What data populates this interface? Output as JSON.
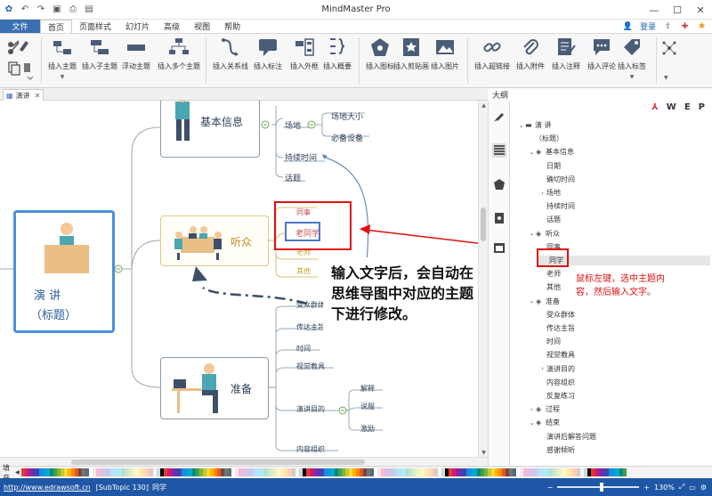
{
  "app": {
    "title": "MindMaster Pro",
    "quick_access": [
      "logo-icon",
      "undo-icon",
      "redo-icon",
      "save-icon",
      "print-icon",
      "export-icon"
    ]
  },
  "menu": {
    "file": "文件",
    "tabs": [
      "首页",
      "页面样式",
      "幻灯片",
      "高级",
      "视图",
      "帮助"
    ],
    "active_index": 0,
    "login": "登录"
  },
  "ribbon": {
    "buttons": [
      {
        "label": "插入主题",
        "icon": "insert-topic-icon"
      },
      {
        "label": "插入子主题",
        "icon": "insert-subtopic-icon"
      },
      {
        "label": "浮动主题",
        "icon": "floating-topic-icon"
      },
      {
        "label": "插入多个主题",
        "icon": "insert-multiple-topics-icon"
      },
      {
        "label": "插入关系线",
        "icon": "relationship-icon"
      },
      {
        "label": "插入标注",
        "icon": "callout-icon"
      },
      {
        "label": "插入外框",
        "icon": "boundary-icon"
      },
      {
        "label": "插入概要",
        "icon": "summary-icon"
      },
      {
        "label": "插入图标",
        "icon": "insert-icon-icon"
      },
      {
        "label": "插入剪贴画",
        "icon": "clipart-icon"
      },
      {
        "label": "插入图片",
        "icon": "picture-icon"
      },
      {
        "label": "插入超链接",
        "icon": "hyperlink-icon"
      },
      {
        "label": "插入附件",
        "icon": "attachment-icon"
      },
      {
        "label": "插入注释",
        "icon": "note-icon"
      },
      {
        "label": "插入评论",
        "icon": "comment-icon"
      },
      {
        "label": "插入标签",
        "icon": "tag-icon"
      }
    ]
  },
  "doc_tab": {
    "label": "演讲"
  },
  "outline": {
    "title": "大纲",
    "tools": [
      "W",
      "E",
      "P"
    ],
    "items": [
      {
        "label": "演    讲",
        "level": 0,
        "arrow": "down",
        "layer": true
      },
      {
        "label": "（标题）",
        "level": 0,
        "arrow": "",
        "layer": false,
        "cont": true
      },
      {
        "label": "基本信息",
        "level": 1,
        "arrow": "down",
        "layer": true
      },
      {
        "label": "日期",
        "level": 2,
        "arrow": "",
        "layer": false
      },
      {
        "label": "确切时间",
        "level": 2,
        "arrow": "",
        "layer": false
      },
      {
        "label": "场地",
        "level": 2,
        "arrow": "right",
        "layer": false
      },
      {
        "label": "持续时间",
        "level": 2,
        "arrow": "",
        "layer": false
      },
      {
        "label": "话题",
        "level": 2,
        "arrow": "",
        "layer": false
      },
      {
        "label": "听众",
        "level": 1,
        "arrow": "down",
        "layer": true
      },
      {
        "label": "同事",
        "level": 2,
        "arrow": "",
        "layer": false
      },
      {
        "label": "同学",
        "level": 2,
        "arrow": "",
        "layer": false,
        "selected": true
      },
      {
        "label": "老师",
        "level": 2,
        "arrow": "",
        "layer": false
      },
      {
        "label": "其他",
        "level": 2,
        "arrow": "",
        "layer": false
      },
      {
        "label": "准备",
        "level": 1,
        "arrow": "down",
        "layer": true
      },
      {
        "label": "受众群体",
        "level": 2,
        "arrow": "",
        "layer": false
      },
      {
        "label": "传达主旨",
        "level": 2,
        "arrow": "",
        "layer": false
      },
      {
        "label": "时间",
        "level": 2,
        "arrow": "",
        "layer": false
      },
      {
        "label": "视觉教具",
        "level": 2,
        "arrow": "",
        "layer": false
      },
      {
        "label": "演讲目的",
        "level": 2,
        "arrow": "right",
        "layer": false
      },
      {
        "label": "内容组织",
        "level": 2,
        "arrow": "",
        "layer": false
      },
      {
        "label": "反复练习",
        "level": 2,
        "arrow": "",
        "layer": false
      },
      {
        "label": "过程",
        "level": 1,
        "arrow": "right",
        "layer": true
      },
      {
        "label": "结束",
        "level": 1,
        "arrow": "down",
        "layer": true
      },
      {
        "label": "演讲后解答问题",
        "level": 2,
        "arrow": "",
        "layer": false
      },
      {
        "label": "感谢倾听",
        "level": 2,
        "arrow": "",
        "layer": false
      }
    ]
  },
  "mindmap": {
    "central": {
      "line1": "演    讲",
      "line2": "（标题）"
    },
    "branches": {
      "basic": "基本信息",
      "audience": "听众",
      "prepare": "准备"
    },
    "subs": {
      "venue": "场地",
      "venue_size": "场地大小",
      "equipment": "必备设备",
      "duration": "持续时间",
      "topic": "话题",
      "colleague": "同事",
      "classmate_edit": "老同学",
      "teacher": "老师",
      "other": "其他",
      "audience_group": "受众群体",
      "main_idea": "传达主旨",
      "time": "时间",
      "visual_aids": "视觉教具",
      "purpose": "演讲目的",
      "explain": "解释",
      "persuade": "说服",
      "inspire": "激励",
      "organize": "内容组织"
    }
  },
  "annotation": {
    "main_line1": "输入文字后，会自动在",
    "main_line2": "思维导图中对应的主题",
    "main_line3": "下进行修改。",
    "side_line1": "鼠标左键，选中主题内",
    "side_line2": "容，然后输入文字。"
  },
  "palette": {
    "label": "填充"
  },
  "status": {
    "link": "http://www.edrawsoft.cn",
    "info": "[SubTopic 130]",
    "selected": "同学",
    "zoom": "130%"
  }
}
